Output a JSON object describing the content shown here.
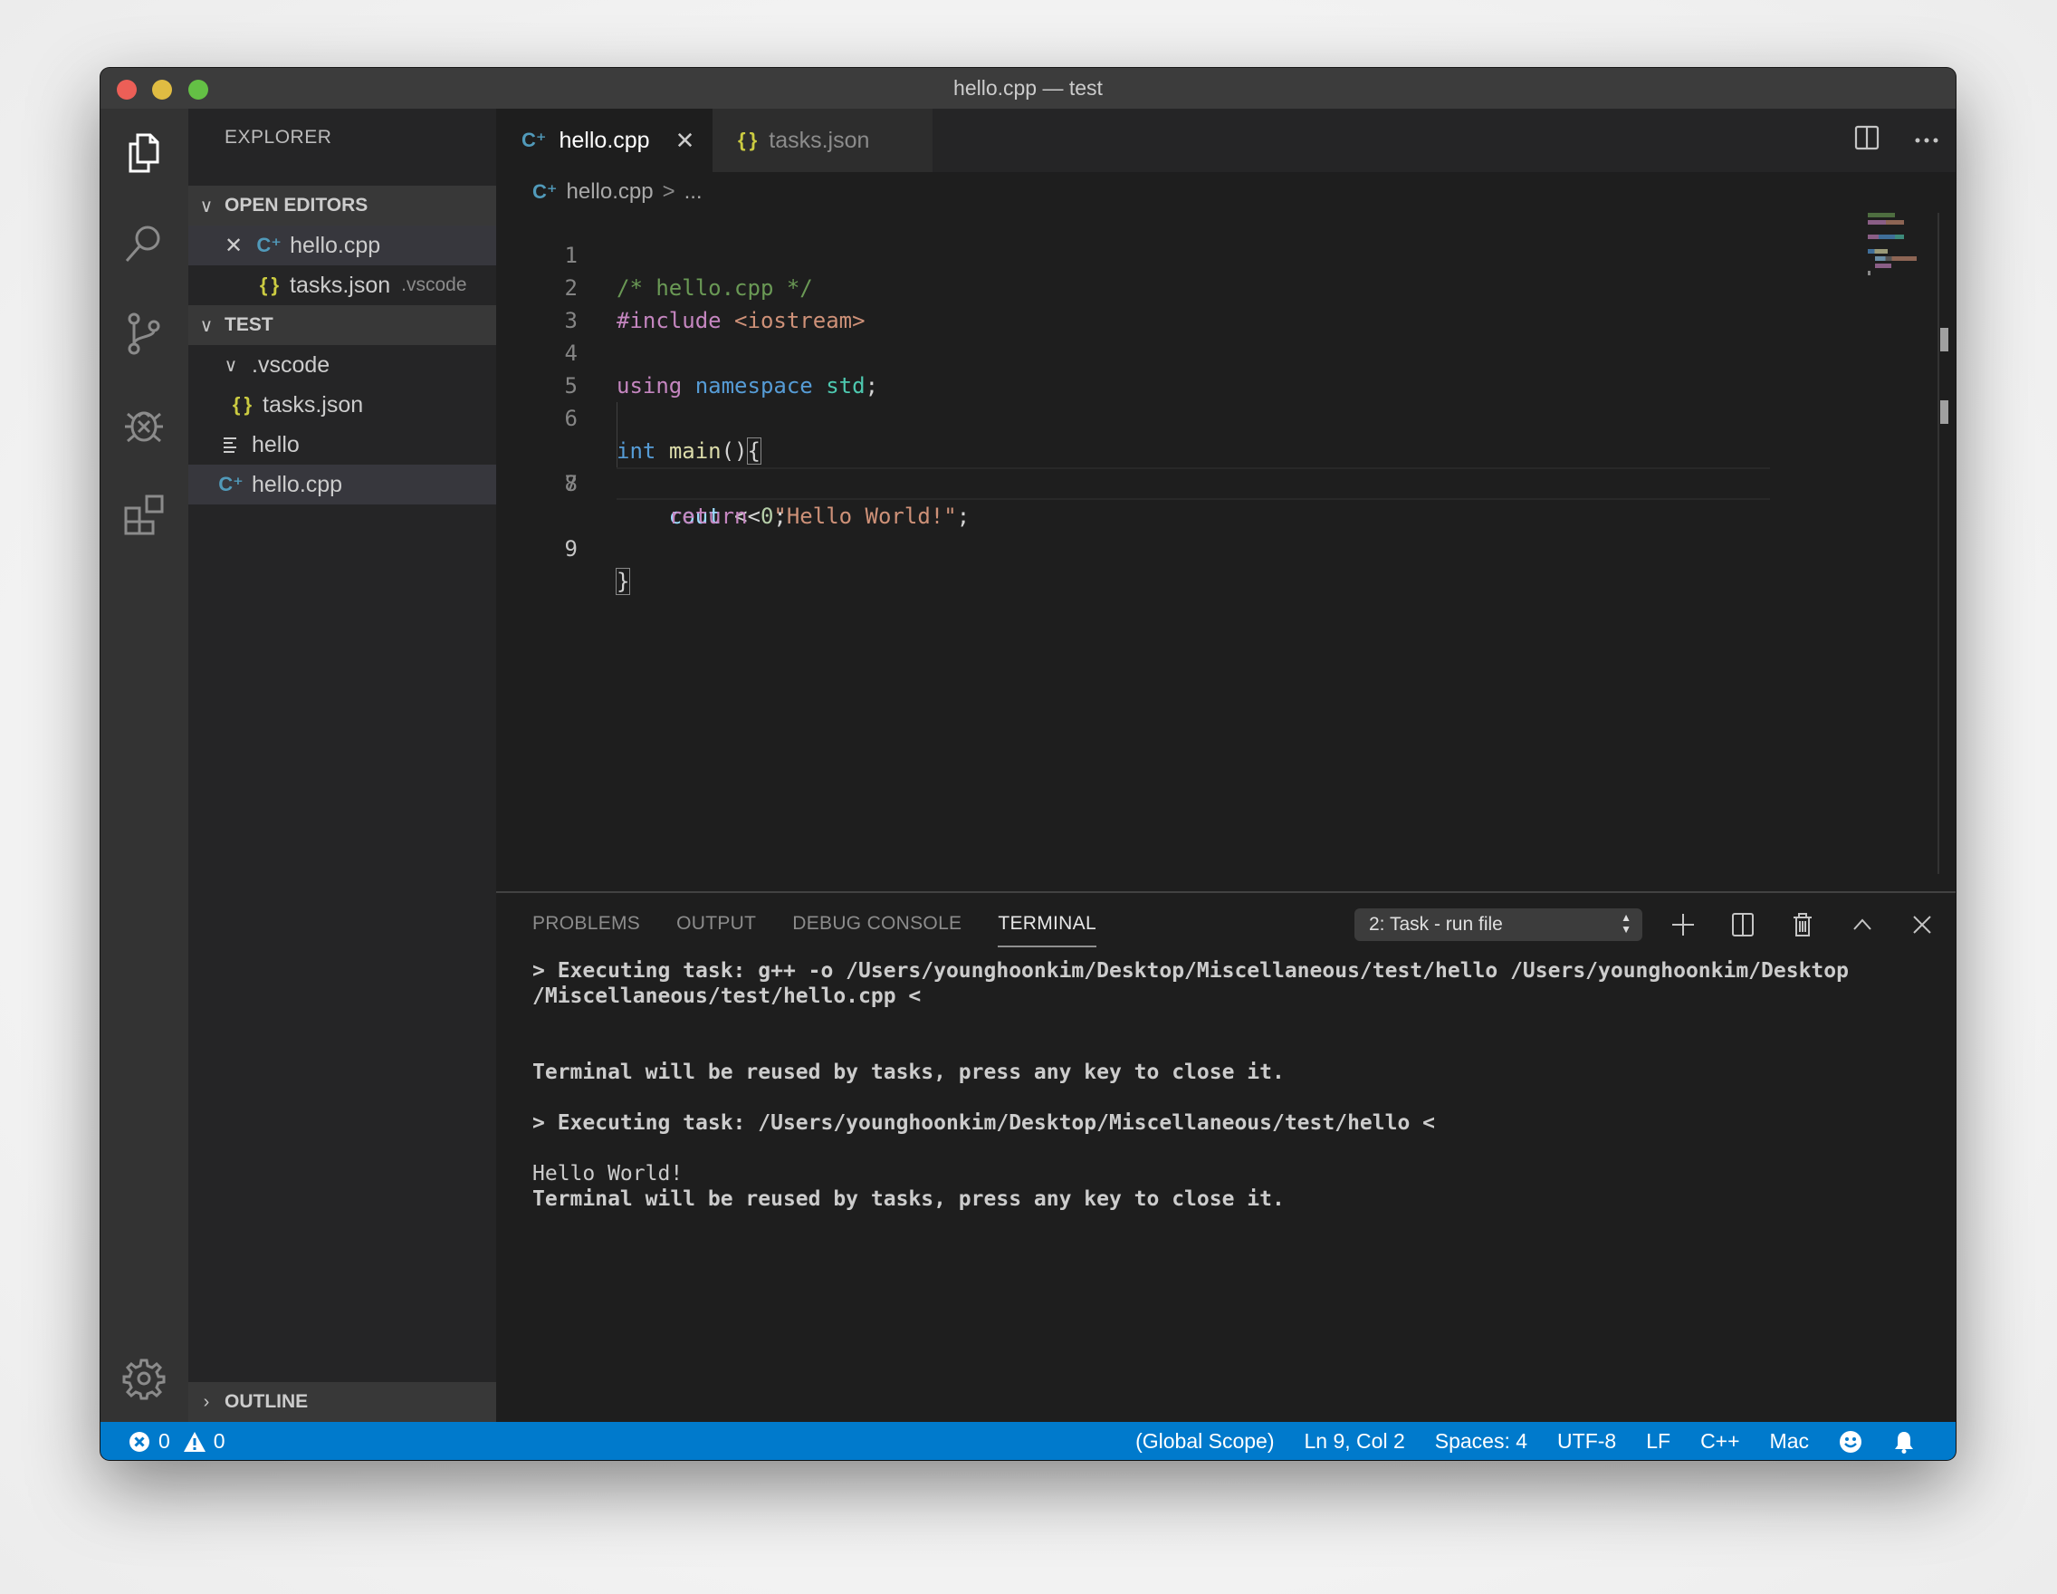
{
  "window": {
    "title": "hello.cpp — test"
  },
  "activity_bar": {
    "items": [
      {
        "name": "explorer",
        "icon": "files-icon"
      },
      {
        "name": "search",
        "icon": "search-icon"
      },
      {
        "name": "source-control",
        "icon": "source-control-icon"
      },
      {
        "name": "debug",
        "icon": "debug-icon"
      },
      {
        "name": "extensions",
        "icon": "extensions-icon"
      }
    ],
    "bottom_icon": "gear-icon"
  },
  "sidebar": {
    "title": "EXPLORER",
    "open_editors": {
      "label": "OPEN EDITORS",
      "items": [
        {
          "label": "hello.cpp",
          "icon": "cpp-icon",
          "description": ""
        },
        {
          "label": "tasks.json",
          "icon": "json-icon",
          "description": ".vscode"
        }
      ]
    },
    "workspace": {
      "label": "TEST",
      "items": [
        {
          "label": ".vscode",
          "type": "folder",
          "expanded": true
        },
        {
          "label": "tasks.json",
          "icon": "json-icon"
        },
        {
          "label": "hello",
          "icon": "file-text-icon"
        },
        {
          "label": "hello.cpp",
          "icon": "cpp-icon"
        }
      ]
    },
    "outline_label": "OUTLINE"
  },
  "editor": {
    "tabs": [
      {
        "label": "hello.cpp",
        "icon": "cpp-icon",
        "active": true
      },
      {
        "label": "tasks.json",
        "icon": "json-icon",
        "active": false
      }
    ],
    "breadcrumb": {
      "file": "hello.cpp",
      "separator": ">",
      "more": "..."
    },
    "lines": [
      {
        "n": "1",
        "text": "/* hello.cpp */"
      },
      {
        "n": "2",
        "text": "#include <iostream>"
      },
      {
        "n": "3",
        "text": ""
      },
      {
        "n": "4",
        "text": "using namespace std;"
      },
      {
        "n": "5",
        "text": ""
      },
      {
        "n": "6",
        "text": "int main(){"
      },
      {
        "n": "7",
        "text": "    cout << \"Hello World!\";"
      },
      {
        "n": "8",
        "text": "    return 0;"
      },
      {
        "n": "9",
        "text": "}"
      }
    ],
    "tokens": {
      "comment": "/* hello.cpp */",
      "include_directive": "#include",
      "include_target": "<iostream>",
      "using_kw": "using",
      "namespace_kw": "namespace",
      "namespace_name": "std",
      "semicolon": ";",
      "int_kw": "int",
      "main_fn": "main",
      "parens": "()",
      "open_brace": "{",
      "indent": "    ",
      "cout": "cout",
      "shift_op": " << ",
      "hello_str": "\"Hello World!\"",
      "return_kw": "return",
      "zero": "0",
      "close_brace": "}",
      "space": " "
    }
  },
  "panel": {
    "tabs": [
      {
        "label": "PROBLEMS",
        "active": false
      },
      {
        "label": "OUTPUT",
        "active": false
      },
      {
        "label": "DEBUG CONSOLE",
        "active": false
      },
      {
        "label": "TERMINAL",
        "active": true
      }
    ],
    "terminal_selector": "2: Task - run file",
    "terminal_lines": [
      {
        "text": "> Executing task: g++ -o /Users/younghoonkim/Desktop/Miscellaneous/test/hello /Users/younghoonkim/Desktop",
        "bold": true
      },
      {
        "text": "/Miscellaneous/test/hello.cpp <",
        "bold": true
      },
      {
        "text": "",
        "bold": false
      },
      {
        "text": "",
        "bold": false
      },
      {
        "text": "Terminal will be reused by tasks, press any key to close it.",
        "bold": true
      },
      {
        "text": "",
        "bold": false
      },
      {
        "text": "> Executing task: /Users/younghoonkim/Desktop/Miscellaneous/test/hello <",
        "bold": true
      },
      {
        "text": "",
        "bold": false
      },
      {
        "text": "Hello World!",
        "bold": false
      },
      {
        "text": "Terminal will be reused by tasks, press any key to close it.",
        "bold": true
      }
    ]
  },
  "status_bar": {
    "errors": "0",
    "warnings": "0",
    "scope": "(Global Scope)",
    "cursor": "Ln 9, Col 2",
    "indent": "Spaces: 4",
    "encoding": "UTF-8",
    "eol": "LF",
    "language": "C++",
    "platform": "Mac"
  },
  "colors": {
    "status_bar": "#007acc",
    "comment": "#6a9955",
    "keyword": "#c586c0",
    "type": "#569cd6",
    "string": "#ce9178",
    "cpp_icon": "#519aba",
    "json_icon": "#cbcb41"
  }
}
